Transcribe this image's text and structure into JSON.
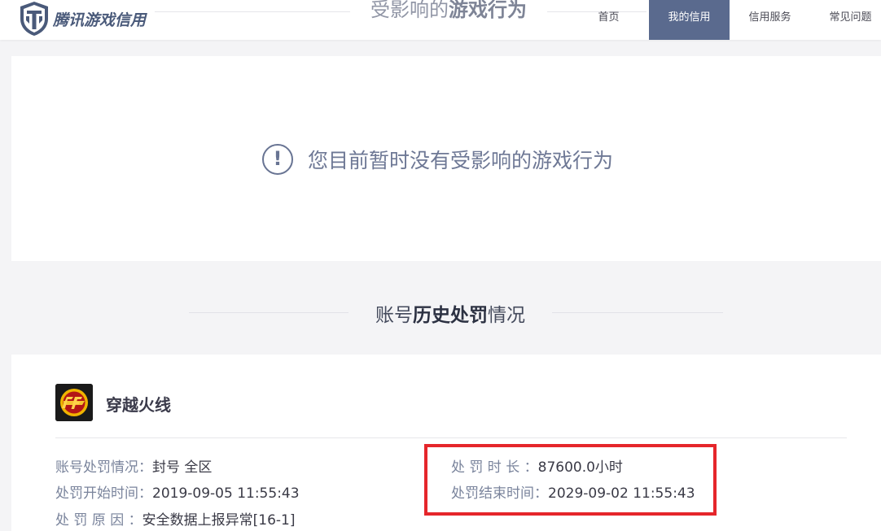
{
  "header": {
    "logo_text": "腾讯游戏信用",
    "title_prefix": "受影响的",
    "title_bold": "游戏行为",
    "nav": [
      {
        "label": "首页",
        "active": false
      },
      {
        "label": "我的信用",
        "active": true
      },
      {
        "label": "信用服务",
        "active": false
      },
      {
        "label": "常见问题",
        "active": false
      }
    ]
  },
  "notice": {
    "icon": "exclamation-circle-icon",
    "message": "您目前暂时没有受影响的游戏行为"
  },
  "history_section": {
    "title_prefix": "账号",
    "title_bold": "历史处罚",
    "title_suffix": "情况"
  },
  "penalty": {
    "game_icon": "crossfire-cf-icon",
    "game_name": "穿越火线",
    "account_status_label": "账号处罚情况：",
    "account_status_value": "封号 全区",
    "start_time_label": "处罚开始时间：",
    "start_time_value": "2019-09-05 11:55:43",
    "reason_label": "处 罚 原 因 ：",
    "reason_value": "安全数据上报异常[16-1]",
    "duration_label": "处 罚 时 长 ：",
    "duration_value": "87600.0小时",
    "end_time_label": "处罚结束时间：",
    "end_time_value": "2029-09-02 11:55:43"
  },
  "colors": {
    "nav_active_bg": "#5a6a8e",
    "highlight_border": "#e5262b",
    "notice_text": "#6e7895"
  }
}
